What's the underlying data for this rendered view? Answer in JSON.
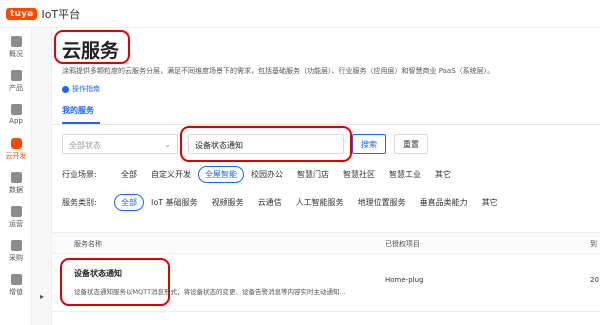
{
  "topbar": {
    "logo": "tuya",
    "platform": "IoT平台"
  },
  "sidebar": {
    "items": [
      {
        "label": "概况",
        "icon": "overview-icon",
        "active": false
      },
      {
        "label": "产品",
        "icon": "product-icon",
        "active": false
      },
      {
        "label": "App",
        "icon": "app-icon",
        "active": false
      },
      {
        "label": "云开发",
        "icon": "cloud-dev-icon",
        "active": true
      },
      {
        "label": "数据",
        "icon": "data-icon",
        "active": false
      },
      {
        "label": "运营",
        "icon": "operation-icon",
        "active": false
      },
      {
        "label": "采购",
        "icon": "purchase-icon",
        "active": false
      },
      {
        "label": "增值",
        "icon": "value-added-icon",
        "active": false
      }
    ],
    "collapse_icon": "▸"
  },
  "page": {
    "title": "云服务",
    "description": "涂鸦提供多颗粒度的云服务分层，满足不同维度场景下的需求，包括基础服务（功能层）、行业服务（应用层）和智慧商业 PaaS（系统层）。",
    "guide": "操作指南",
    "tab": "我的服务"
  },
  "search": {
    "status_placeholder": "全部状态",
    "query": "设备状态通知",
    "search_label": "搜索",
    "reset_label": "重置"
  },
  "filters": {
    "industry_label": "行业场景:",
    "industry": [
      "全部",
      "自定义开发",
      "全屋智能",
      "校园办公",
      "智慧门店",
      "智慧社区",
      "智慧工业",
      "其它"
    ],
    "industry_active": 2,
    "category_label": "服务类别:",
    "category": [
      "全部",
      "IoT 基础服务",
      "视频服务",
      "云通信",
      "人工智能服务",
      "地理位置服务",
      "垂直品类能力",
      "其它"
    ],
    "category_active": 0
  },
  "table": {
    "columns": [
      "服务名称",
      "已授权项目",
      "到"
    ],
    "rows": [
      {
        "name": "设备状态通知",
        "desc": "设备状态通知服务以MQTT消息形式，将设备状态的变更、设备告警消息等内容实时主动通知...",
        "project": "Home-plug",
        "cut": "20"
      }
    ]
  },
  "colors": {
    "accent": "#1a66ff",
    "brand": "#ff4800",
    "annotation": "#e00000"
  }
}
